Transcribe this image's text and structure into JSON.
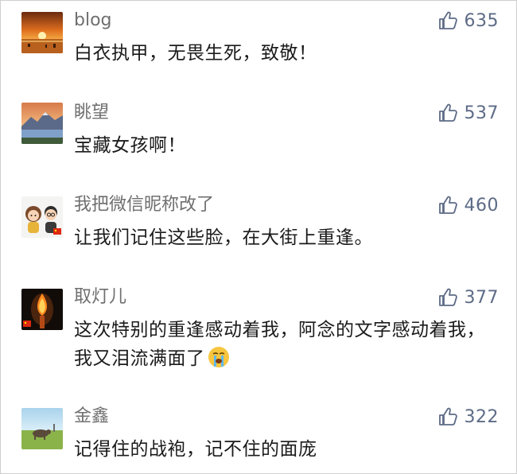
{
  "comments": [
    {
      "nickname": "blog",
      "likes": "635",
      "text": "白衣执甲，无畏生死，致敬！",
      "avatar_icon": "sunset-beach-avatar"
    },
    {
      "nickname": "眺望",
      "likes": "537",
      "text": "宝藏女孩啊！",
      "avatar_icon": "mountain-lake-avatar"
    },
    {
      "nickname": "我把微信昵称改了",
      "likes": "460",
      "text": "让我们记住这些脸，在大街上重逢。",
      "avatar_icon": "cartoon-couple-avatar"
    },
    {
      "nickname": "取灯儿",
      "likes": "377",
      "text": "这次特别的重逢感动着我，阿念的文字感动着我，我又泪流满面了",
      "emoji": "crying-face-emoji",
      "avatar_icon": "candle-flame-avatar"
    },
    {
      "nickname": "金鑫",
      "likes": "322",
      "text": "记得住的战袍，记不住的面庞",
      "avatar_icon": "grassland-animal-avatar"
    }
  ],
  "colors": {
    "nickname": "#6f6f6f",
    "text": "#1b1b1b",
    "like": "#5d6b86",
    "background": "#ffffff"
  }
}
